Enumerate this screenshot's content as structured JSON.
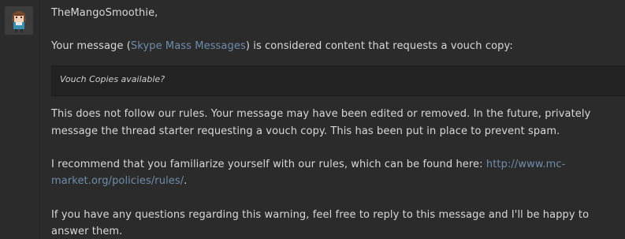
{
  "greeting": "TheMangoSmoothie,",
  "message_intro": {
    "before": "Your message (",
    "link": "Skype Mass Messages",
    "after": ") is considered content that requests a vouch copy:"
  },
  "quote": "Vouch Copies available?",
  "rules_paragraph": {
    "line1": "This does not follow our rules. Your message may have been edited or removed. In the future, privately",
    "line2": "message the thread starter requesting a vouch copy. This has been put in place to prevent spam."
  },
  "recommend_paragraph": {
    "line1_text": "I recommend that you familiarize yourself with our rules, which can be found here: ",
    "line1_link": "http://www.mc-",
    "line2_link": "market.org/policies/rules/",
    "line2_after": "."
  },
  "questions_paragraph": {
    "line1": "If you have any questions regarding this warning, feel free to reply to this message and I'll be happy to",
    "line2": "answer them."
  },
  "colors": {
    "background": "#2b2b2b",
    "text": "#d8d8d8",
    "link": "#6f8dab",
    "quote_background": "#222222"
  }
}
